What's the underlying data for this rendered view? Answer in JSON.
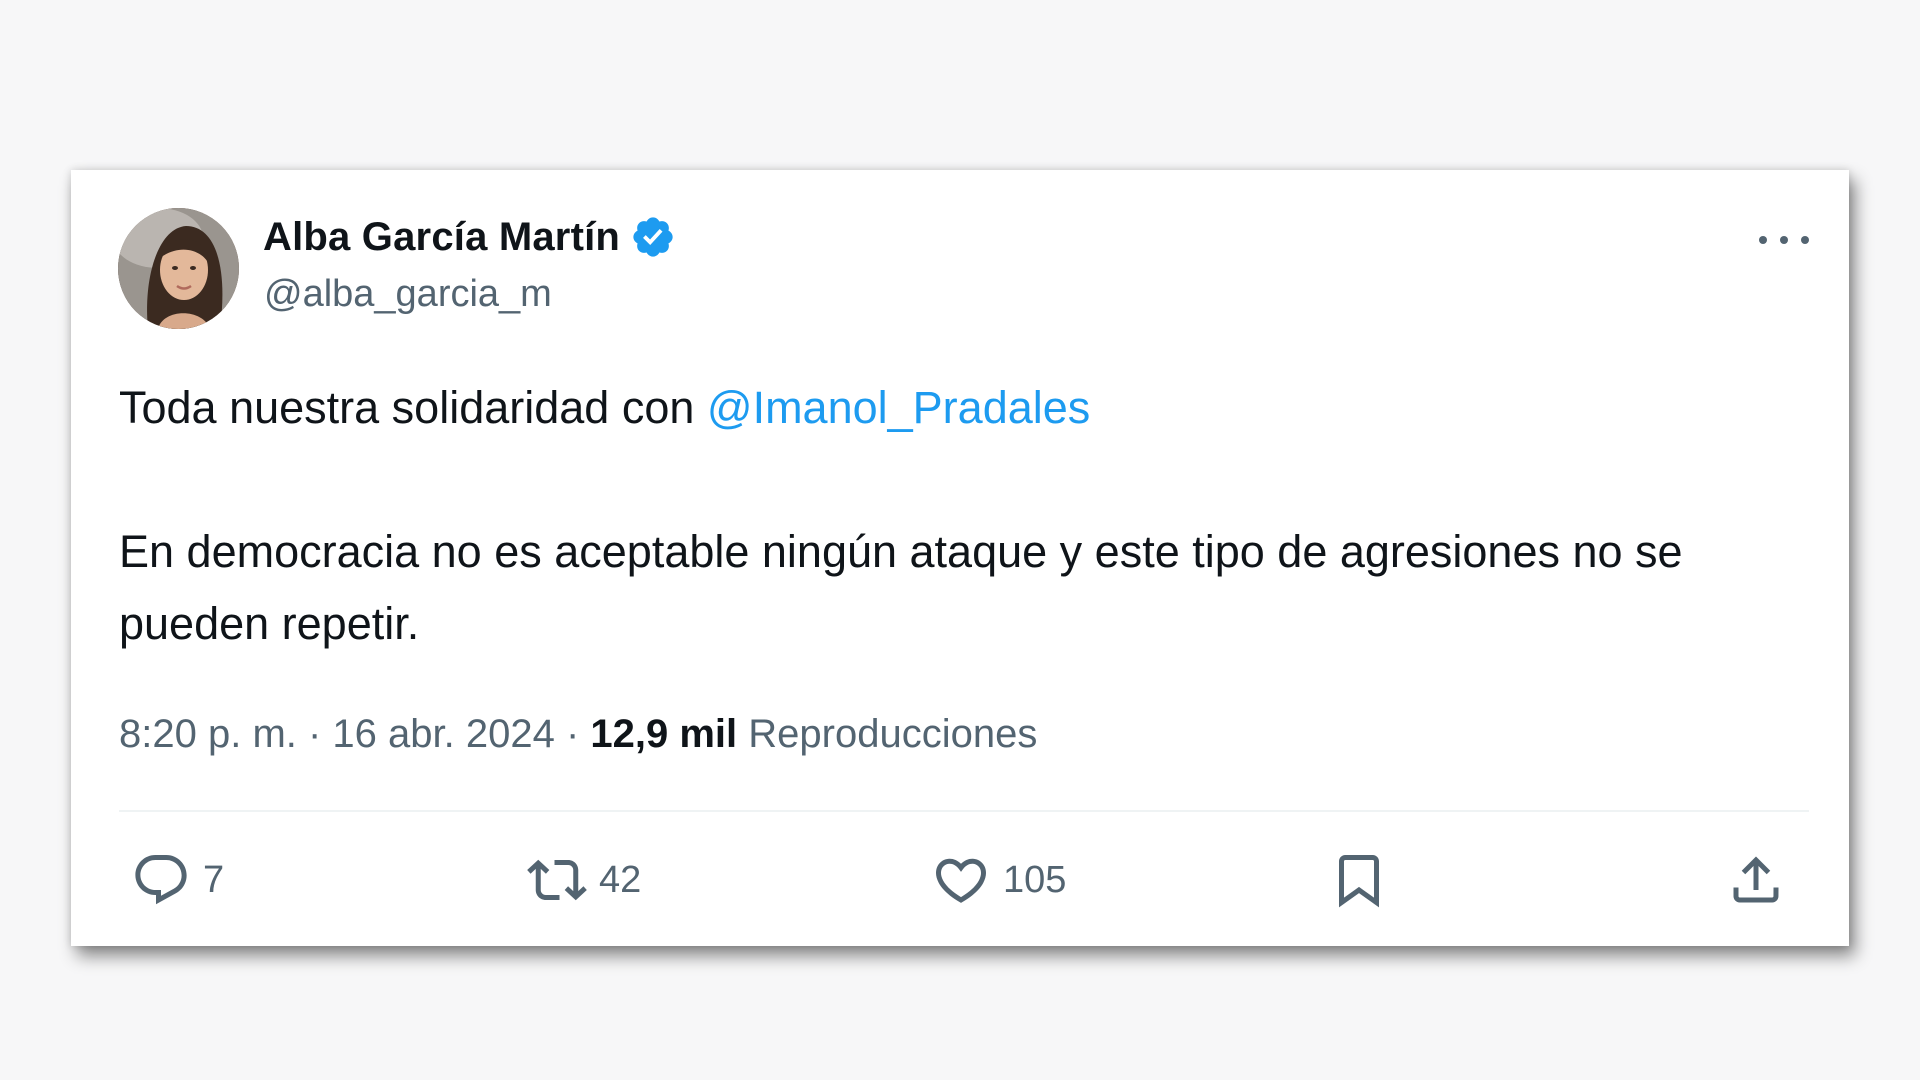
{
  "tweet": {
    "author": {
      "name": "Alba García Martín",
      "handle": "@alba_garcia_m",
      "verified": true
    },
    "text": {
      "line1_prefix": "Toda nuestra solidaridad con ",
      "mention": "@Imanol_Pradales",
      "paragraph2": "En democracia no es aceptable ningún ataque y este tipo de agresiones no se pueden repetir."
    },
    "meta": {
      "time": "8:20 p. m.",
      "separator": " · ",
      "date": "16 abr. 2024",
      "views_count": "12,9 mil",
      "views_label": " Reproducciones"
    },
    "actions": {
      "replies": "7",
      "retweets": "42",
      "likes": "105"
    }
  },
  "colors": {
    "accent": "#1d9bf0",
    "text_primary": "#0f1419",
    "text_secondary": "#536471"
  },
  "icons": {
    "verified": "verified-badge-icon",
    "more": "more-options-icon",
    "reply": "reply-icon",
    "retweet": "retweet-icon",
    "like": "heart-icon",
    "bookmark": "bookmark-icon",
    "share": "share-icon"
  }
}
